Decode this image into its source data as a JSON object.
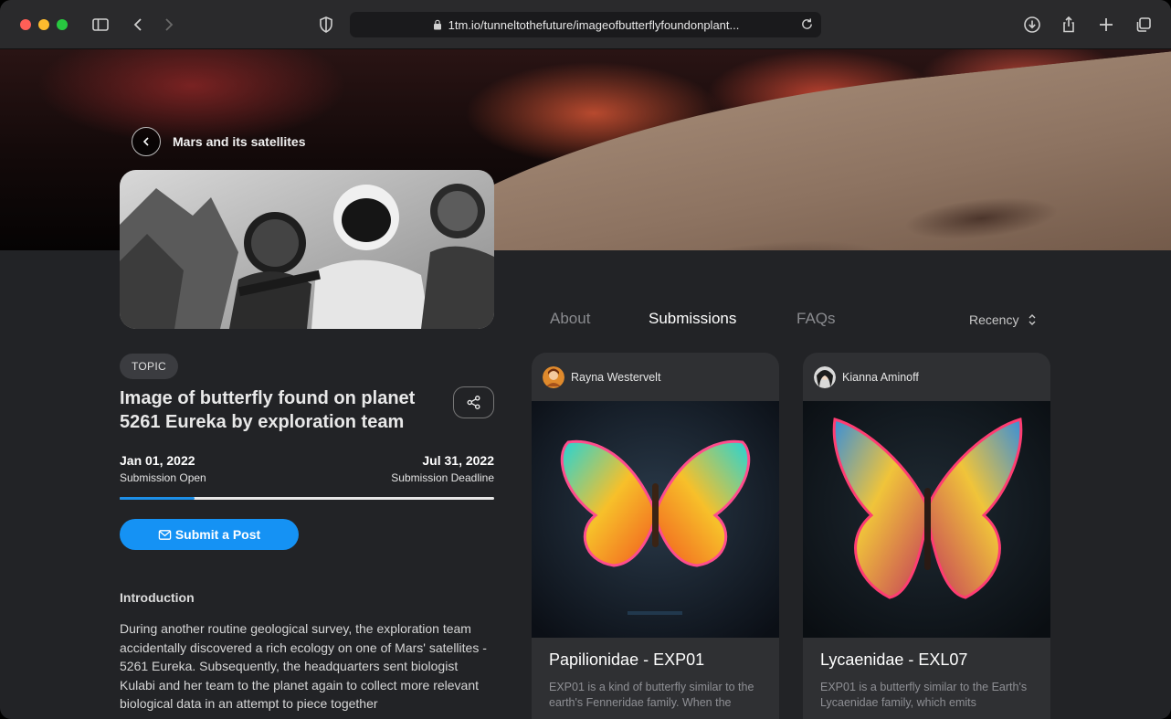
{
  "browser": {
    "url": "1tm.io/tunneltothefuture/imageofbutterflyfoundonplant..."
  },
  "nav": {
    "back_label": "Mars and its satellites"
  },
  "topic": {
    "badge": "TOPIC",
    "title": "Image of butterfly found on planet 5261 Eureka by exploration team",
    "open_date": "Jan 01, 2022",
    "open_label": "Submission Open",
    "deadline_date": "Jul 31, 2022",
    "deadline_label": "Submission Deadline",
    "progress_fraction": 0.2,
    "submit_label": "Submit a Post"
  },
  "intro": {
    "heading": "Introduction",
    "text": "During another routine geological survey, the exploration team accidentally discovered a rich ecology on one of Mars' satellites - 5261 Eureka. Subsequently, the headquarters sent biologist Kulabi and her team to the planet again to collect more relevant biological data in an attempt to piece together"
  },
  "tabs": [
    {
      "label": "About"
    },
    {
      "label": "Submissions"
    },
    {
      "label": "FAQs"
    }
  ],
  "sort": {
    "label": "Recency"
  },
  "cards": [
    {
      "author": "Rayna Westervelt",
      "title": "Papilionidae - EXP01",
      "desc": "EXP01 is a kind of butterfly similar to the earth's Fenneridae family. When the"
    },
    {
      "author": "Kianna Aminoff",
      "title": "Lycaenidae - EXL07",
      "desc": "EXP01 is a butterfly similar to the Earth's Lycaenidae family, which emits"
    }
  ],
  "colors": {
    "accent": "#1592f4",
    "background": "#222326",
    "card": "#2f3033"
  }
}
